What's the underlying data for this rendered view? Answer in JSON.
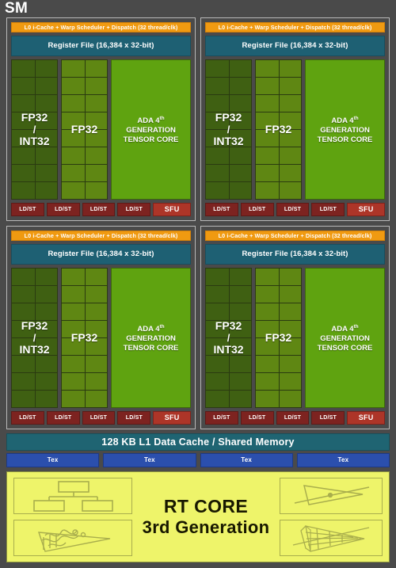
{
  "diagram": {
    "title": "SM",
    "type": "nvidia-ada-streaming-multiprocessor-block-diagram"
  },
  "processing_block": {
    "scheduler_label": "L0 i-Cache + Warp Scheduler + Dispatch (32 thread/clk)",
    "register_file_label": "Register File (16,384 x 32-bit)",
    "columns": [
      {
        "name": "fp32-int32",
        "line1": "FP32",
        "slash": "/",
        "line2": "INT32",
        "cell_rows": 8
      },
      {
        "name": "fp32",
        "line1": "FP32",
        "cell_rows": 8
      },
      {
        "name": "tensor-core",
        "line1": "ADA 4",
        "superscript": "th",
        "line2": "GENERATION",
        "line3": "TENSOR CORE"
      }
    ],
    "ldst_label": "LD/ST",
    "ldst_count": 4,
    "sfu_label": "SFU"
  },
  "quadrants": [
    {
      "id": "processing-block-0"
    },
    {
      "id": "processing-block-1"
    },
    {
      "id": "processing-block-2"
    },
    {
      "id": "processing-block-3"
    }
  ],
  "l1_cache": {
    "label": "128 KB L1 Data Cache / Shared Memory"
  },
  "tex_units": {
    "label": "Tex",
    "count": 4
  },
  "rt_core": {
    "line1": "RT CORE",
    "line2": "3rd Generation",
    "icons": [
      {
        "name": "bvh-tree-icon",
        "position": "top-left"
      },
      {
        "name": "ray-triangle-intersection-icon",
        "position": "top-right"
      },
      {
        "name": "triangle-scribble-icon",
        "position": "bottom-left"
      },
      {
        "name": "bvh-mesh-traversal-icon",
        "position": "bottom-right"
      }
    ]
  },
  "colors": {
    "background": "#4a4a4a",
    "scheduler_orange": "#f09a11",
    "register_file_teal": "#1e6073",
    "fp32_int32_green": "#3f6012",
    "fp32_green": "#5f8713",
    "tensor_core_green": "#5fa310",
    "ldst_red": "#7d2320",
    "sfu_red": "#ad3528",
    "l1_cache_teal": "#1f6472",
    "tex_blue": "#2b4fad",
    "rt_core_yellow": "#eef46a"
  }
}
